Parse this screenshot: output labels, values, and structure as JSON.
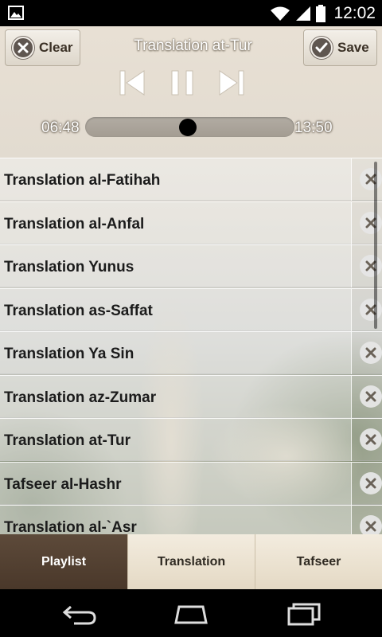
{
  "status_bar": {
    "time": "12:02",
    "icons": [
      "image-notification-icon",
      "wifi-icon",
      "signal-icon",
      "battery-icon"
    ]
  },
  "header": {
    "clear_label": "Clear",
    "save_label": "Save",
    "now_playing": "Translation at-Tur",
    "current_time": "06:48",
    "total_time": "13:50",
    "progress": 0.49
  },
  "playlist": {
    "items": [
      {
        "label": "Translation al-Fatihah"
      },
      {
        "label": "Translation al-Anfal"
      },
      {
        "label": "Translation Yunus"
      },
      {
        "label": "Translation as-Saffat"
      },
      {
        "label": "Translation Ya Sin"
      },
      {
        "label": "Translation az-Zumar"
      },
      {
        "label": "Translation at-Tur"
      },
      {
        "label": "Tafseer al-Hashr"
      },
      {
        "label": "Translation al-`Asr"
      }
    ]
  },
  "tabs": [
    {
      "label": "Playlist",
      "active": true
    },
    {
      "label": "Translation",
      "active": false
    },
    {
      "label": "Tafseer",
      "active": false
    }
  ],
  "colors": {
    "active_tab": "#4f3c2d",
    "inactive_tab": "#ebe2d0"
  }
}
